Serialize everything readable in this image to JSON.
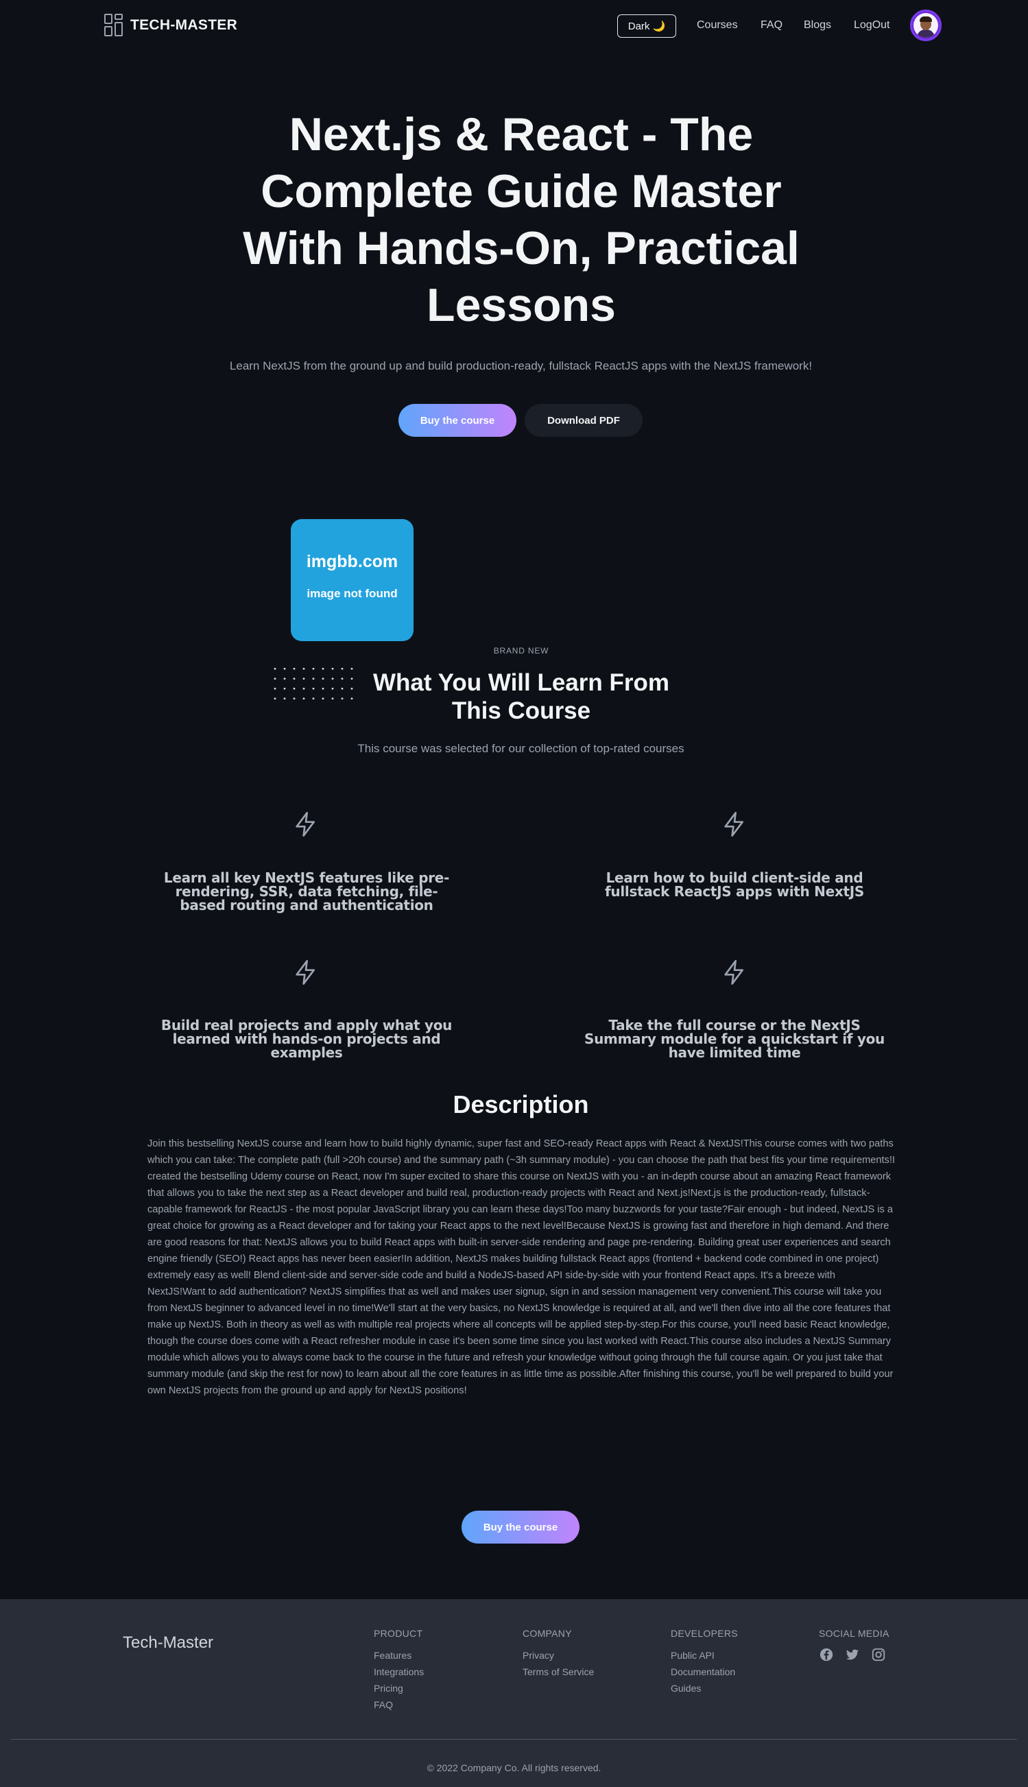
{
  "nav": {
    "brand": "TECH-MASTER",
    "theme_toggle": "Dark 🌙",
    "links": [
      "Courses",
      "FAQ",
      "Blogs",
      "LogOut"
    ]
  },
  "hero": {
    "title": "Next.js & React - The Complete Guide Master With Hands-On, Practical Lessons",
    "subtitle": "Learn NextJS from the ground up and build production-ready, fullstack ReactJS apps with the NextJS framework!",
    "buy_button": "Buy the course",
    "download_button": "Download PDF"
  },
  "image_placeholder": {
    "line1": "imgbb.com",
    "line2": "image not found"
  },
  "learn": {
    "eyebrow": "BRAND NEW",
    "title": "What You Will Learn From This Course",
    "subtitle": "This course was selected for our collection of top-rated courses",
    "features": [
      {
        "icon": "lightning-icon",
        "text": "Learn all key NextJS features like pre-rendering, SSR, data fetching, file-based routing and authentication"
      },
      {
        "icon": "lightning-icon",
        "text": "Learn how to build client-side and fullstack ReactJS apps with NextJS"
      },
      {
        "icon": "lightning-icon",
        "text": "Build real projects and apply what you learned with hands-on projects and examples"
      },
      {
        "icon": "lightning-icon",
        "text": "Take the full course or the NextJS Summary module for a quickstart if you have limited time"
      }
    ]
  },
  "description": {
    "title": "Description",
    "body": "Join this bestselling NextJS course and learn how to build highly dynamic, super fast and SEO-ready React apps with React & NextJS!This course comes with two paths which you can take: The complete path (full >20h course) and the summary path (~3h summary module) - you can choose the path that best fits your time requirements!I created the bestselling Udemy course on React, now I'm super excited to share this course on NextJS with you - an in-depth course about an amazing React framework that allows you to take the next step as a React developer and build real, production-ready projects with React and Next.js!Next.js is the production-ready, fullstack-capable framework for ReactJS - the most popular JavaScript library you can learn these days!Too many buzzwords for your taste?Fair enough - but indeed, NextJS is a great choice for growing as a React developer and for taking your React apps to the next level!Because NextJS is growing fast and therefore in high demand. And there are good reasons for that: NextJS allows you to build React apps with built-in server-side rendering and page pre-rendering. Building great user experiences and search engine friendly (SEO!) React apps has never been easier!In addition, NextJS makes building fullstack React apps (frontend + backend code combined in one project) extremely easy as well! Blend client-side and server-side code and build a NodeJS-based API side-by-side with your frontend React apps. It's a breeze with NextJS!Want to add authentication? NextJS simplifies that as well and makes user signup, sign in and session management very convenient.This course will take you from NextJS beginner to advanced level in no time!We'll start at the very basics, no NextJS knowledge is required at all, and we'll then dive into all the core features that make up NextJS. Both in theory as well as with multiple real projects where all concepts will be applied step-by-step.For this course, you'll need basic React knowledge, though the course does come with a React refresher module in case it's been some time since you last worked with React.This course also includes a NextJS Summary module which allows you to always come back to the course in the future and refresh your knowledge without going through the full course again. Or you just take that summary module (and skip the rest for now) to learn about all the core features in as little time as possible.After finishing this course, you'll be well prepared to build your own NextJS projects from the ground up and apply for NextJS positions!",
    "buy_button": "Buy the course"
  },
  "footer": {
    "brand": "Tech-Master",
    "columns": [
      {
        "heading": "PRODUCT",
        "links": [
          "Features",
          "Integrations",
          "Pricing",
          "FAQ"
        ]
      },
      {
        "heading": "COMPANY",
        "links": [
          "Privacy",
          "Terms of Service"
        ]
      },
      {
        "heading": "DEVELOPERS",
        "links": [
          "Public API",
          "Documentation",
          "Guides"
        ]
      }
    ],
    "social_heading": "SOCIAL MEDIA",
    "social_icons": [
      "facebook-icon",
      "twitter-icon",
      "instagram-icon"
    ],
    "copyright": "© 2022 Company Co. All rights reserved."
  },
  "colors": {
    "background": "#0d1117",
    "footer_background": "#282d38",
    "gradient_start": "#60a5fa",
    "gradient_end": "#c084fc",
    "placeholder_blue": "#23a3de"
  }
}
